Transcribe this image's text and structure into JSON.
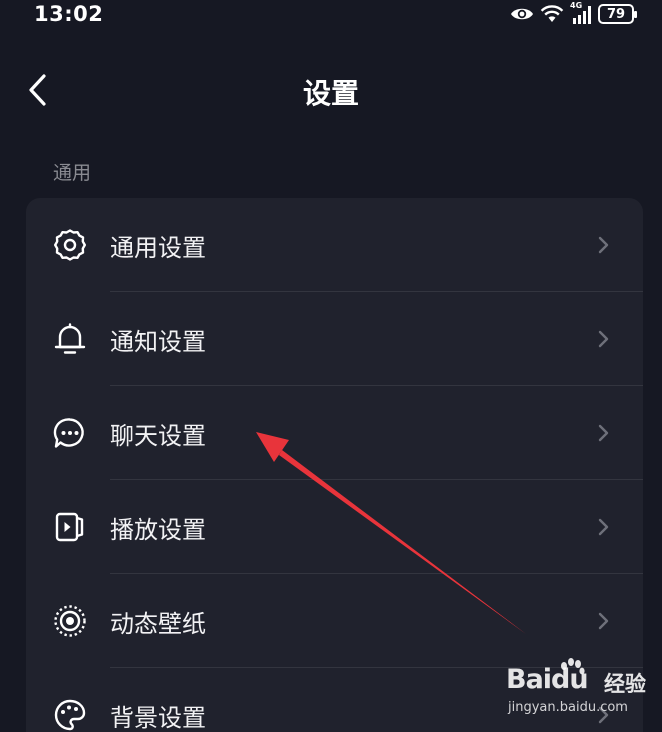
{
  "status_bar": {
    "time": "13:02",
    "network": "4G",
    "battery": "79",
    "icons": [
      "eye-icon",
      "wifi-icon",
      "signal-icon",
      "battery-icon"
    ]
  },
  "header": {
    "title": "设置",
    "back_icon": "chevron-left-icon"
  },
  "section": {
    "label": "通用"
  },
  "settings": [
    {
      "label": "通用设置",
      "icon": "gear-icon"
    },
    {
      "label": "通知设置",
      "icon": "bell-icon"
    },
    {
      "label": "聊天设置",
      "icon": "chat-bubble-icon"
    },
    {
      "label": "播放设置",
      "icon": "play-icon"
    },
    {
      "label": "动态壁纸",
      "icon": "live-wallpaper-icon"
    },
    {
      "label": "背景设置",
      "icon": "palette-icon"
    }
  ],
  "annotation": {
    "color": "#e8343b"
  },
  "watermark": {
    "brand": "Baidu",
    "product": "经验",
    "url": "jingyan.baidu.com"
  },
  "colors": {
    "background": "#161823",
    "card": "#20222d",
    "text": "#f2f2f4",
    "muted": "#8a8b92"
  }
}
